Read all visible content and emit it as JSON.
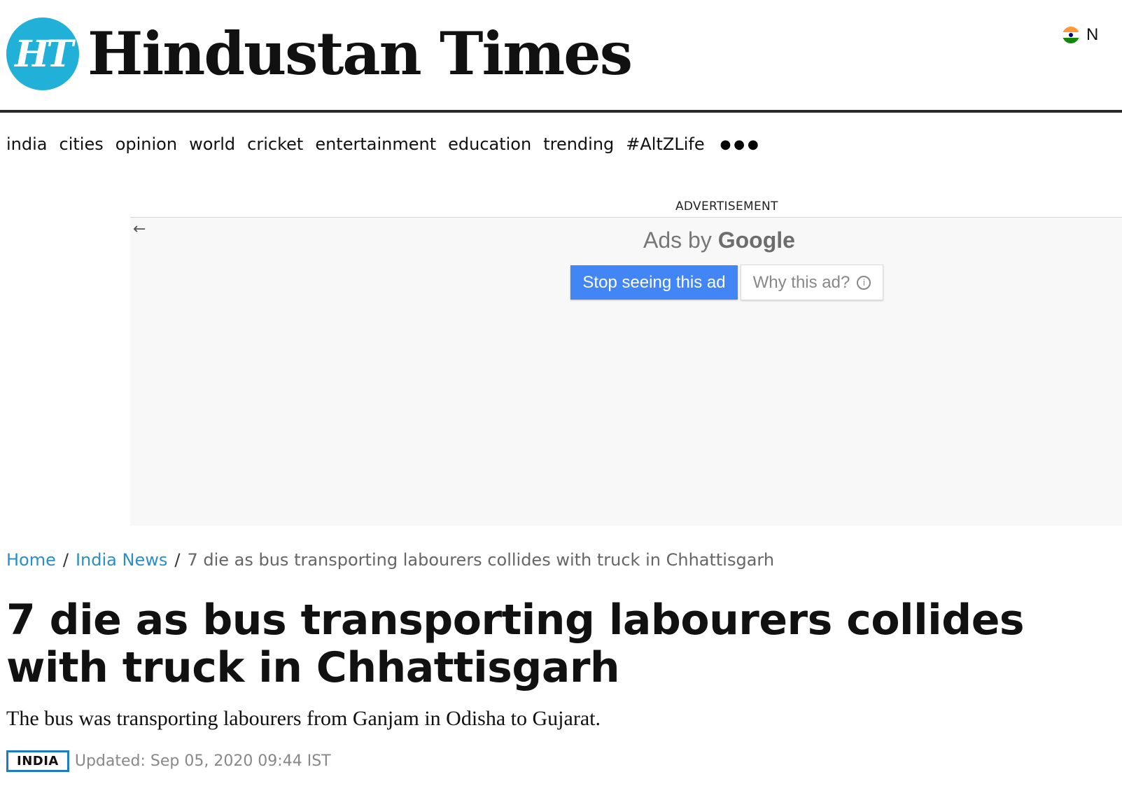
{
  "header": {
    "logo_mark": "HT",
    "logo_text": "Hindustan Times",
    "edition_label": "N",
    "edition_icon": "india-flag-icon"
  },
  "nav": {
    "items": [
      "india",
      "cities",
      "opinion",
      "world",
      "cricket",
      "entertainment",
      "education",
      "trending",
      "#AltZLife"
    ],
    "more_icon": "more-dots-icon",
    "more_glyph": "●●●"
  },
  "ad": {
    "label": "ADVERTISEMENT",
    "back_icon": "back-arrow-icon",
    "back_glyph": "←",
    "ads_by": "Ads by",
    "brand": "Google",
    "stop_label": "Stop seeing this ad",
    "why_label": "Why this ad?",
    "info_glyph": "i"
  },
  "breadcrumb": {
    "home": "Home",
    "section": "India News",
    "separator": "/",
    "current": "7 die as bus transporting labourers collides with truck in Chhattisgarh"
  },
  "article": {
    "headline": "7 die as bus transporting labourers collides with truck in Chhattisgarh",
    "standfirst": "The bus was transporting labourers from Ganjam in Odisha to Gujarat.",
    "section_badge": "INDIA",
    "updated": "Updated: Sep 05, 2020 09:44 IST"
  },
  "colors": {
    "logo": "#20b0d8",
    "link": "#2a8fc5",
    "badge_border": "#1b7ec2",
    "ad_button": "#4285f4"
  }
}
